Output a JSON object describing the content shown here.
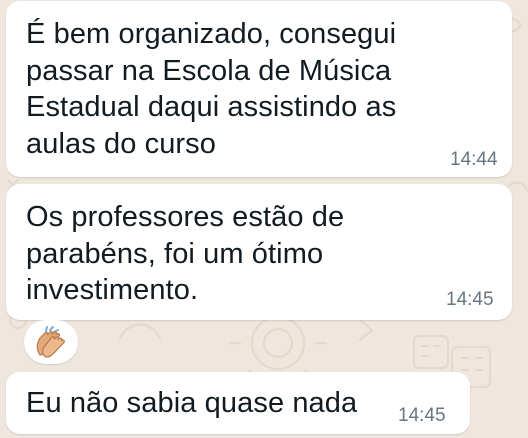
{
  "chat": {
    "messages": [
      {
        "text": "É bem organizado, consegui\npassar na Escola de Música\nEstadual daqui assistindo as\naulas do curso",
        "time": "14:44"
      },
      {
        "text": "Os professores estão de\nparabéns, foi um ótimo\ninvestimento.",
        "time": "14:45"
      },
      {
        "text": "Eu não sabia quase nada",
        "time": "14:45"
      }
    ],
    "reaction": {
      "icon": "clapping-hands-icon",
      "skin_color": "#e2a878"
    },
    "colors": {
      "wallpaper": "#efe7de",
      "bubble": "#ffffff",
      "text": "#111b21",
      "timestamp": "#667781"
    }
  }
}
